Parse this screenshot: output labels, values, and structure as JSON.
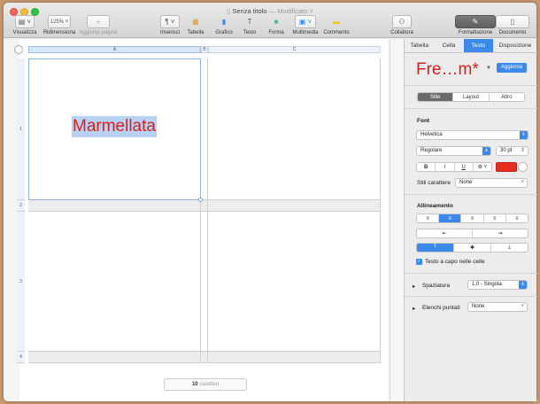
{
  "window": {
    "title": "Senza titolo",
    "status": "— Modificato ˅"
  },
  "toolbar": [
    {
      "name": "visualizza",
      "label": "Visualizza",
      "icon": "▤ ˅",
      "dim": false
    },
    {
      "name": "ridimensiona",
      "label": "Ridimensiona",
      "icon": "125% ˅",
      "dim": false
    },
    {
      "name": "aggiungi-pagina",
      "label": "Aggiungi pagina",
      "icon": "+",
      "dim": true
    },
    {
      "name": "inserisci",
      "label": "Inserisci",
      "icon": "¶ ˅",
      "dim": false
    },
    {
      "name": "tabella",
      "label": "Tabella",
      "icon": "▦",
      "dim": false
    },
    {
      "name": "grafico",
      "label": "Grafico",
      "icon": "▮",
      "dim": false
    },
    {
      "name": "testo",
      "label": "Testo",
      "icon": "T",
      "dim": false
    },
    {
      "name": "forma",
      "label": "Forma",
      "icon": "■",
      "dim": false
    },
    {
      "name": "multimedia",
      "label": "Multimedia",
      "icon": "▣ ˅",
      "dim": false
    },
    {
      "name": "commento",
      "label": "Commento",
      "icon": "▬",
      "dim": false
    },
    {
      "name": "collabora",
      "label": "Collabora",
      "icon": "⚇",
      "dim": false
    },
    {
      "name": "formattazione",
      "label": "Formattazione",
      "icon": "✎",
      "dim": false
    },
    {
      "name": "documento",
      "label": "Documento",
      "icon": "▯",
      "dim": false
    }
  ],
  "table": {
    "columns": [
      "A",
      "B",
      "C"
    ],
    "rows": [
      "1",
      "2",
      "3",
      "4"
    ],
    "cell_text": "Marmellata"
  },
  "counter": {
    "count": "10",
    "unit": "caratteri"
  },
  "inspector": {
    "tabs": [
      "Tabella",
      "Cella",
      "Testo",
      "Disposizione"
    ],
    "active_tab": "Testo",
    "style_name": "Fre…m*",
    "update_button": "Aggiorna",
    "subtabs": [
      "Stile",
      "Layout",
      "Altro"
    ],
    "font_section": "Font",
    "font_family": "Helvetica",
    "font_weight": "Regolare",
    "font_size": "30 pt",
    "format_buttons": [
      "B",
      "I",
      "U",
      "⚙ ˅"
    ],
    "text_color": "#e82c1c",
    "char_styles_label": "Stili carattere",
    "char_styles_value": "None",
    "align_section": "Allineamento",
    "wrap_label": "Testo a capo nelle celle",
    "spacing_label": "Spaziatura",
    "spacing_value": "1,0 - Singola",
    "bullets_label": "Elenchi puntati",
    "bullets_value": "None"
  },
  "colors": {
    "accent": "#3b8aeb",
    "text_red": "#d42020",
    "selection": "#b8d3f2"
  }
}
